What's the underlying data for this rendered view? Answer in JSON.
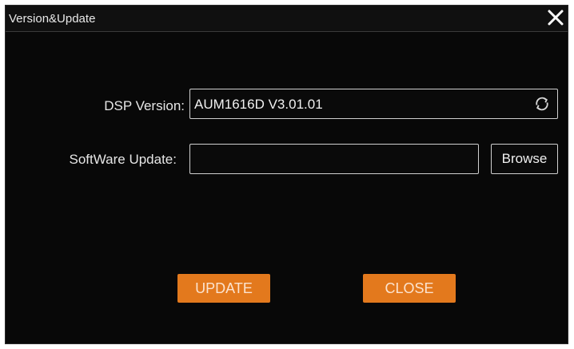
{
  "window": {
    "title": "Version&Update"
  },
  "dsp": {
    "label": "DSP Version:",
    "value": "AUM1616D V3.01.01"
  },
  "software": {
    "label": "SoftWare Update:",
    "value": "",
    "browse_label": "Browse"
  },
  "buttons": {
    "update_label": "UPDATE",
    "close_label": "CLOSE"
  },
  "colors": {
    "accent": "#e3791d",
    "background": "#080808",
    "border": "#d0d0d0"
  },
  "icons": {
    "close": "close-icon",
    "refresh": "refresh-icon"
  }
}
